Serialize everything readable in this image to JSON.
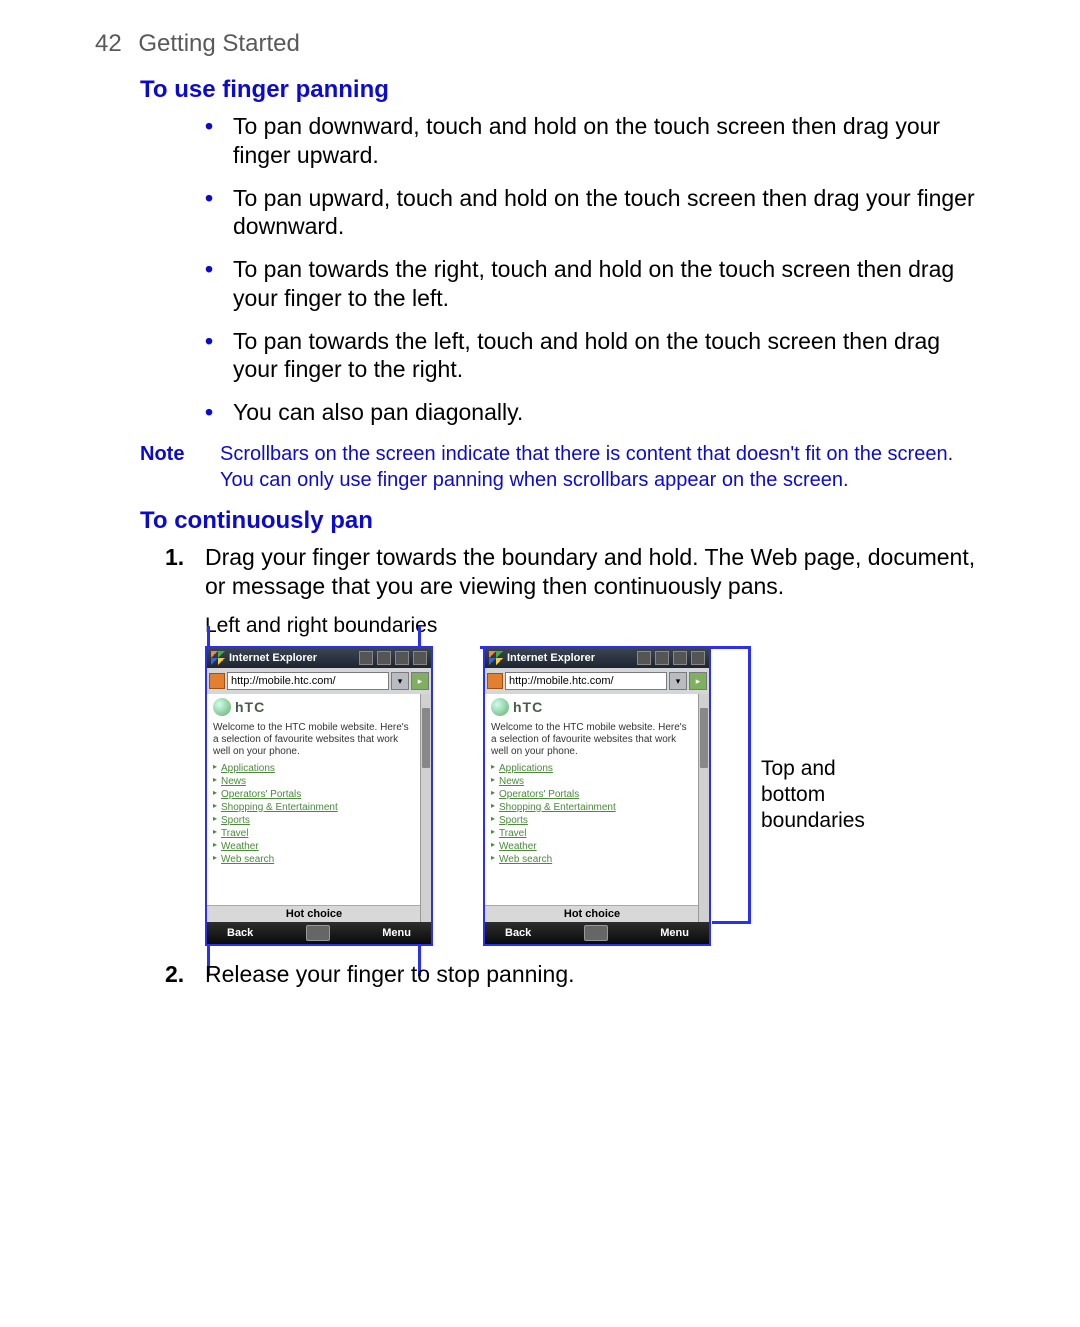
{
  "header": {
    "page_number": "42",
    "section": "Getting Started"
  },
  "section1": {
    "title": "To use finger panning",
    "bullets": [
      "To pan downward, touch and hold on the touch screen then drag your finger upward.",
      "To pan upward, touch and hold on the touch screen then drag your finger downward.",
      "To pan towards the right, touch and hold on the touch screen then drag your finger to the left.",
      "To pan towards the left, touch and hold on the touch screen then drag your finger to the right.",
      "You can also pan diagonally."
    ]
  },
  "note": {
    "label": "Note",
    "text": "Scrollbars on the screen indicate that there is content that doesn't fit on the screen. You can only use finger panning when scrollbars appear on the screen."
  },
  "section2": {
    "title": "To continuously pan",
    "steps": [
      "Drag your finger towards the boundary and hold. The Web page, document, or message that you are viewing then continuously pans.",
      "Release your finger to stop panning."
    ]
  },
  "figures": {
    "caption_lr": "Left and right boundaries",
    "caption_tb": "Top and bottom boundaries",
    "phone": {
      "title": "Internet Explorer",
      "url": "http://mobile.htc.com/",
      "brand": "hTC",
      "welcome": "Welcome to the HTC mobile website. Here's a selection of favourite websites that work well on your phone.",
      "links": [
        "Applications",
        "News",
        "Operators' Portals",
        "Shopping & Entertainment",
        "Sports",
        "Travel",
        "Weather",
        "Web search"
      ],
      "hot": "Hot choice",
      "soft_left": "Back",
      "soft_right": "Menu"
    }
  }
}
